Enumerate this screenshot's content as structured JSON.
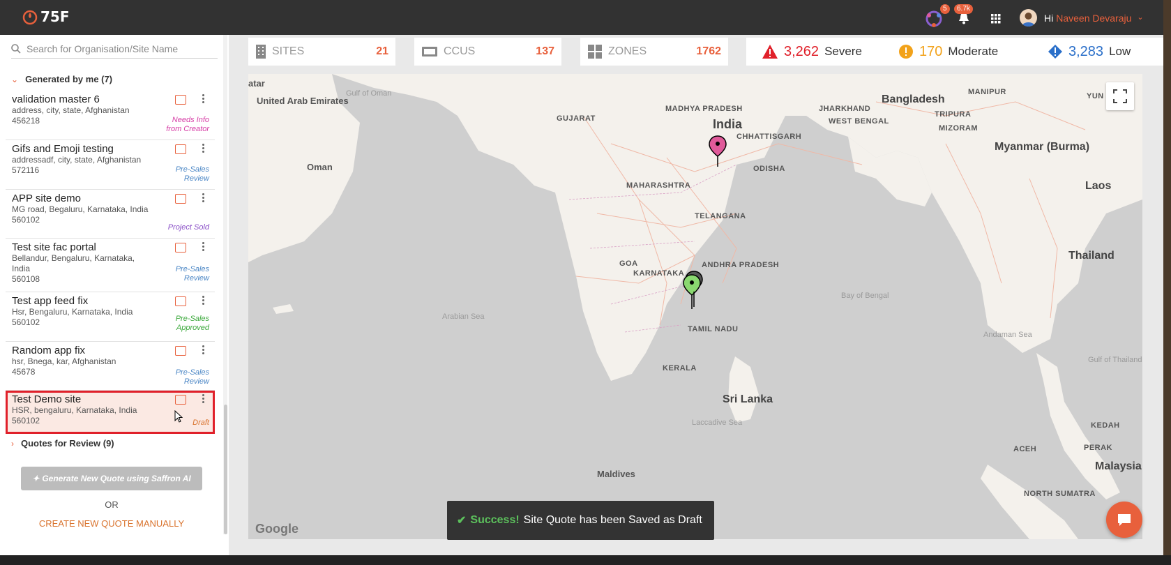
{
  "brand": {
    "name": "75F"
  },
  "header": {
    "badge_a": "5",
    "badge_b": "6.7k",
    "greeting": "Hi",
    "user_name": "Naveen Devaraju"
  },
  "sidebar": {
    "search_placeholder": "Search for Organisation/Site Name",
    "group_generated": "Generated by me (7)",
    "group_review": "Quotes for Review (9)",
    "items": [
      {
        "name": "validation master 6",
        "address": "address, city, state, Afghanistan",
        "zip": "456218",
        "status": "Needs Info from Creator",
        "status_color": "#d63ca5"
      },
      {
        "name": "Gifs and Emoji testing",
        "address": "addressadf, city, state, Afghanistan",
        "zip": "572116",
        "status": "Pre-Sales Review",
        "status_color": "#4a86c5"
      },
      {
        "name": "APP site demo",
        "address": "MG road, Begaluru, Karnataka, India",
        "zip": "560102",
        "status": "Project Sold",
        "status_color": "#8a4fc7"
      },
      {
        "name": "Test site fac portal",
        "address": "Bellandur, Bengaluru, Karnataka, India",
        "zip": "560108",
        "status": "Pre-Sales Review",
        "status_color": "#4a86c5"
      },
      {
        "name": "Test app feed fix",
        "address": "Hsr, Bengaluru, Karnataka, India",
        "zip": "560102",
        "status": "Pre-Sales Approved",
        "status_color": "#3aa83a"
      },
      {
        "name": "Random app fix",
        "address": "hsr, Bnega, kar, Afghanistan",
        "zip": "45678",
        "status": "Pre-Sales Review",
        "status_color": "#4a86c5"
      },
      {
        "name": "Test Demo site",
        "address": "HSR, bengaluru, Karnataka, India",
        "zip": "560102",
        "status": "Draft",
        "status_color": "#d9722c"
      }
    ],
    "generate_button": "Generate New Quote using Saffron AI",
    "or_label": "OR",
    "manual_link": "CREATE NEW QUOTE MANUALLY"
  },
  "stats": {
    "sites_label": "SITES",
    "sites_value": "21",
    "ccus_label": "CCUS",
    "ccus_value": "137",
    "zones_label": "ZONES",
    "zones_value": "1762",
    "severe_value": "3,262",
    "severe_label": "Severe",
    "moderate_value": "170",
    "moderate_label": "Moderate",
    "low_value": "3,283",
    "low_label": "Low"
  },
  "map": {
    "labels": {
      "atar": "atar",
      "uae": "United Arab Emirates",
      "gulf_oman": "Gulf of Oman",
      "oman": "Oman",
      "gujarat": "GUJARAT",
      "madhya": "MADHYA PRADESH",
      "india": "India",
      "jharkhand": "JHARKHAND",
      "wbengal": "WEST BENGAL",
      "bangladesh": "Bangladesh",
      "manipur": "MANIPUR",
      "tripura": "TRIPURA",
      "mizoram": "MIZORAM",
      "chhattisgarh": "CHHATTISGARH",
      "odisha": "ODISHA",
      "maharashtra": "MAHARASHTRA",
      "telangana": "TELANGANA",
      "myanmar": "Myanmar (Burma)",
      "laos": "Laos",
      "goa": "GOA",
      "karnataka": "KARNATAKA",
      "andhra": "ANDHRA PRADESH",
      "arabian": "Arabian Sea",
      "bay": "Bay of Bengal",
      "andaman": "Andaman Sea",
      "thailand": "Thailand",
      "tamil": "TAMIL NADU",
      "kerala": "KERALA",
      "srilanka": "Sri Lanka",
      "laccadive": "Laccadive Sea",
      "gulf_thailand": "Gulf of Thailand",
      "kedah": "KEDAH",
      "aceh": "ACEH",
      "perak": "PERAK",
      "malaysia": "Malaysia",
      "nsumatra": "NORTH SUMATRA",
      "maldives": "Maldives",
      "yun": "YUN"
    },
    "attribution": "Google"
  },
  "toast": {
    "title": "Success!",
    "message": "Site Quote has been Saved as Draft"
  }
}
